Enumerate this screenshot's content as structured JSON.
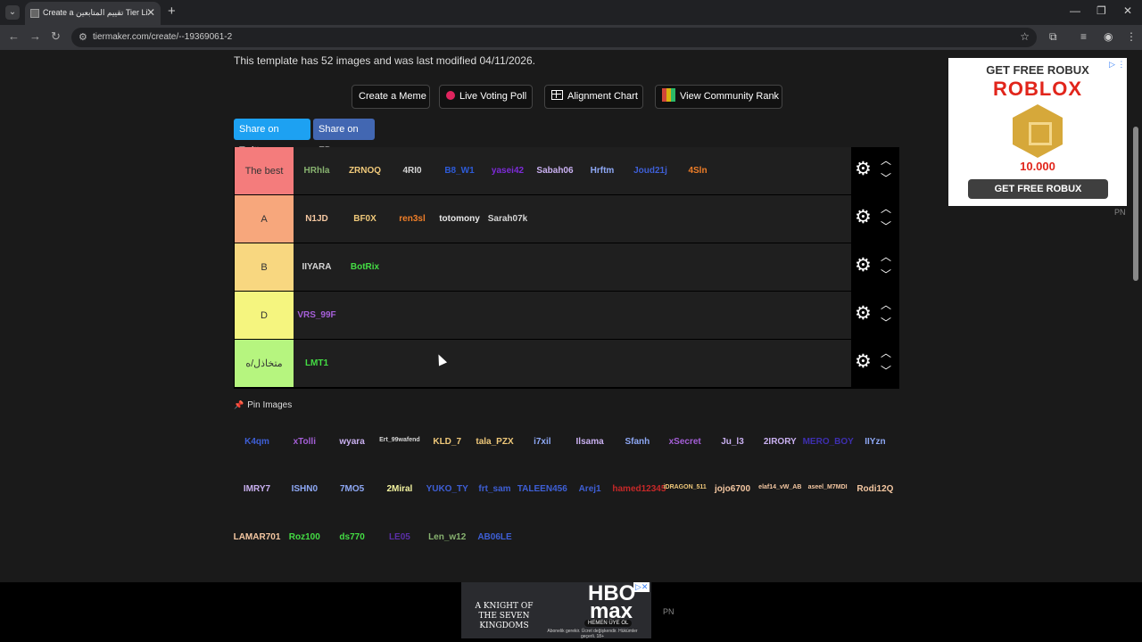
{
  "browser": {
    "tab_title": "Create a تقييم المتابعين Tier List",
    "url": "tiermaker.com/create/--19369061-2",
    "tab_list_icon": "chevron-down-icon",
    "new_tab_label": "+",
    "close_tab_label": "✕",
    "back_label": "←",
    "forward_label": "→",
    "reload_label": "↻",
    "site_info_label": "⚙",
    "bookmark_label": "☆",
    "extensions_label": "⧉",
    "menu_label": "⋮",
    "minimize_label": "—",
    "maximize_label": "❐",
    "close_window_label": "✕"
  },
  "page": {
    "info_text": "This template has 52 images and was last modified 04/11/2026.",
    "buttons": {
      "meme": "Create a Meme",
      "poll": "Live Voting Poll",
      "alignment": "Alignment Chart",
      "rank": "View Community Rank"
    },
    "share": {
      "twitter": "Share on Twitter",
      "fb": "Share on FB"
    },
    "tiers": [
      {
        "label": "The best",
        "color": "#f47c7c"
      },
      {
        "label": "A",
        "color": "#f7a77c"
      },
      {
        "label": "B",
        "color": "#f8d780"
      },
      {
        "label": "D",
        "color": "#f5f57f"
      },
      {
        "label": "متخاذل/ه",
        "color": "#b6f57f"
      }
    ],
    "tier_items": [
      [
        "HRhla",
        "ZRNOQ",
        "4RI0",
        "B8_W1",
        "yasei42",
        "Sabah06",
        "Hrftm",
        "Joud21j",
        "4Sln"
      ],
      [
        "N1JD",
        "BF0X",
        "ren3sl",
        "totomony",
        "Sarah07k"
      ],
      [
        "IIYARA",
        "BotRix"
      ],
      [
        "VRS_99F"
      ],
      [
        "LMT1"
      ]
    ],
    "control_icons": {
      "gear": "⚙",
      "up": "︿",
      "down": "﹀"
    },
    "pin_label": "Pin Images",
    "pin_icon": "📌",
    "pool_rows": [
      [
        "K4qm",
        "xTolli",
        "wyara",
        "Ert_99wafend",
        "KLD_7",
        "tala_PZX",
        "i7xil",
        "Ilsama",
        "Sfanh",
        "xSecret",
        "Ju_l3",
        "2IRORY",
        "MERO_BOY",
        "IIYzn"
      ],
      [
        "IMRY7",
        "ISHN0",
        "7MO5",
        "2Miral",
        "YUKO_TY",
        "frt_sam",
        "TALEEN456",
        "Arej1",
        "hamed12345",
        "iDRAGON_511",
        "jojo6700",
        "elaf14_vW_AB",
        "aseel_M7MDI",
        "Rodi12Q"
      ],
      [
        "LAMAR701",
        "Roz100",
        "ds770",
        "LE05",
        "Len_w12",
        "AB06LE"
      ]
    ]
  },
  "ads": {
    "right_h1": "GET FREE ROBUX",
    "right_brand": "ROBLOX",
    "right_amount": "10.000",
    "right_cta": "GET FREE ROBUX",
    "right_tag": "PN",
    "bottom_show": "A KNIGHT OF THE SEVEN KINGDOMS",
    "bottom_brand": "HBO max",
    "bottom_sub": "HEMEN ÜYE OL",
    "bottom_fine": "Abonelik gerekir. Ücret değişkendir. Hükümler geçerli. 18+",
    "bottom_tag": "PN"
  }
}
